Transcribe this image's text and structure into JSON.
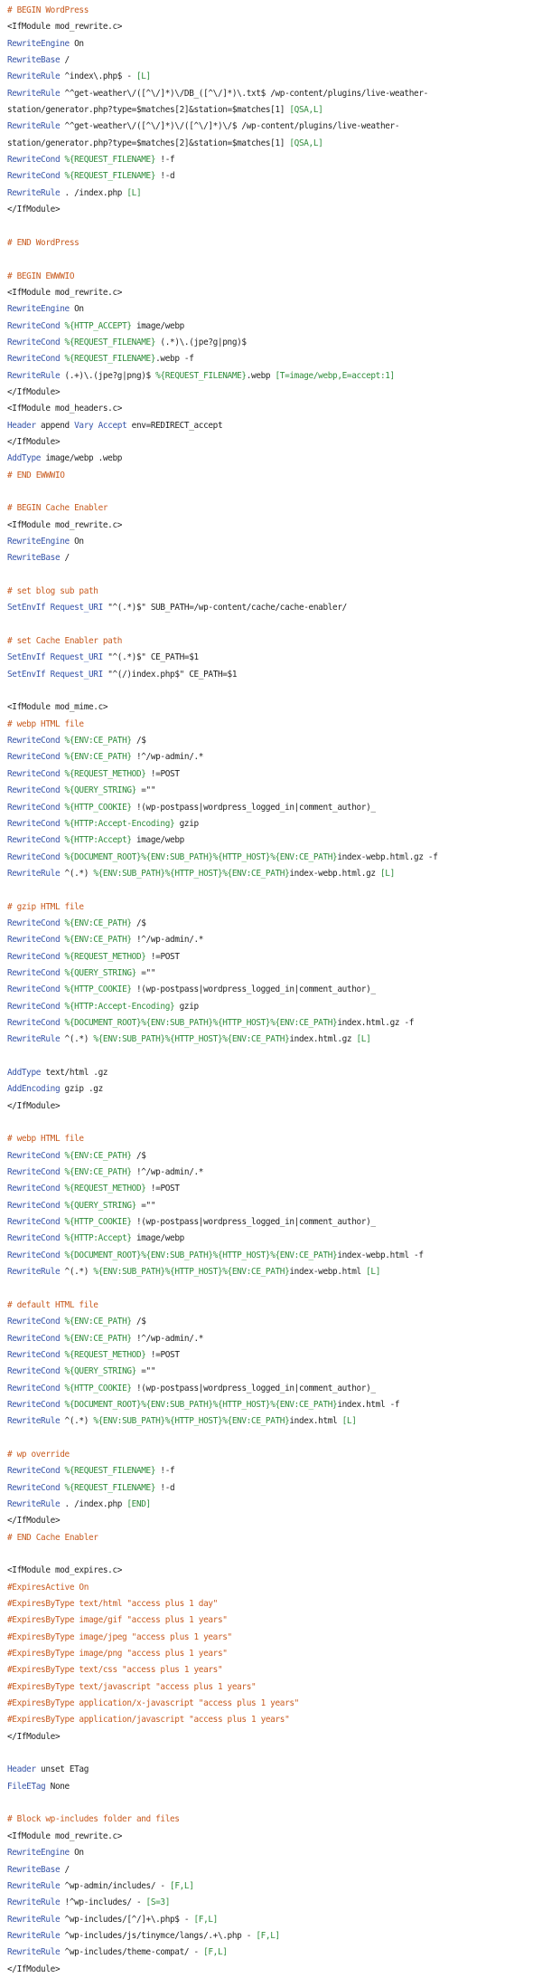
{
  "colors": {
    "comment": "#c85a1e",
    "directive": "#3553a8",
    "variable": "#2e8b3a",
    "text": "#222222",
    "background": "#ffffff"
  },
  "lines": [
    [
      [
        "c",
        "# BEGIN WordPress"
      ]
    ],
    [
      [
        "t",
        "<IfModule mod_rewrite.c>"
      ]
    ],
    [
      [
        "d",
        "RewriteEngine"
      ],
      [
        "p",
        " On"
      ]
    ],
    [
      [
        "d",
        "RewriteBase"
      ],
      [
        "p",
        " /"
      ]
    ],
    [
      [
        "d",
        "RewriteRule"
      ],
      [
        "p",
        " ^index\\.php$ - "
      ],
      [
        "f",
        "[L]"
      ]
    ],
    [
      [
        "d",
        "RewriteRule"
      ],
      [
        "p",
        " ^^get-weather\\/([^\\/]*)\\/DB_([^\\/]*)\\.txt$ /wp-content/plugins/live-weather-"
      ]
    ],
    [
      [
        "p",
        "station/generator.php?type=$matches[2]&station=$matches[1] "
      ],
      [
        "f",
        "[QSA,L]"
      ]
    ],
    [
      [
        "d",
        "RewriteRule"
      ],
      [
        "p",
        " ^^get-weather\\/([^\\/]*)\\/([^\\/]*)\\/$ /wp-content/plugins/live-weather-"
      ]
    ],
    [
      [
        "p",
        "station/generator.php?type=$matches[2]&station=$matches[1] "
      ],
      [
        "f",
        "[QSA,L]"
      ]
    ],
    [
      [
        "d",
        "RewriteCond"
      ],
      [
        "p",
        " "
      ],
      [
        "v",
        "%{REQUEST_FILENAME}"
      ],
      [
        "p",
        " !-f"
      ]
    ],
    [
      [
        "d",
        "RewriteCond"
      ],
      [
        "p",
        " "
      ],
      [
        "v",
        "%{REQUEST_FILENAME}"
      ],
      [
        "p",
        " !-d"
      ]
    ],
    [
      [
        "d",
        "RewriteRule"
      ],
      [
        "p",
        " . /index.php "
      ],
      [
        "f",
        "[L]"
      ]
    ],
    [
      [
        "t",
        "</IfModule>"
      ]
    ],
    [],
    [
      [
        "c",
        "# END WordPress"
      ]
    ],
    [],
    [
      [
        "c",
        "# BEGIN EWWWIO"
      ]
    ],
    [
      [
        "t",
        "<IfModule mod_rewrite.c>"
      ]
    ],
    [
      [
        "d",
        "RewriteEngine"
      ],
      [
        "p",
        " On"
      ]
    ],
    [
      [
        "d",
        "RewriteCond"
      ],
      [
        "p",
        " "
      ],
      [
        "v",
        "%{HTTP_ACCEPT}"
      ],
      [
        "p",
        " image/webp"
      ]
    ],
    [
      [
        "d",
        "RewriteCond"
      ],
      [
        "p",
        " "
      ],
      [
        "v",
        "%{REQUEST_FILENAME}"
      ],
      [
        "p",
        " (.*)\\.(jpe?g|png)$"
      ]
    ],
    [
      [
        "d",
        "RewriteCond"
      ],
      [
        "p",
        " "
      ],
      [
        "v",
        "%{REQUEST_FILENAME}"
      ],
      [
        "p",
        ".webp -f"
      ]
    ],
    [
      [
        "d",
        "RewriteRule"
      ],
      [
        "p",
        " (.+)\\.(jpe?g|png)$ "
      ],
      [
        "v",
        "%{REQUEST_FILENAME}"
      ],
      [
        "p",
        ".webp "
      ],
      [
        "f",
        "[T=image/webp,E=accept:1]"
      ]
    ],
    [
      [
        "t",
        "</IfModule>"
      ]
    ],
    [
      [
        "t",
        "<IfModule mod_headers.c>"
      ]
    ],
    [
      [
        "d",
        "Header"
      ],
      [
        "p",
        " append "
      ],
      [
        "d",
        "Vary"
      ],
      [
        "p",
        " "
      ],
      [
        "d",
        "Accept"
      ],
      [
        "p",
        " env=REDIRECT_accept"
      ]
    ],
    [
      [
        "t",
        "</IfModule>"
      ]
    ],
    [
      [
        "d",
        "AddType"
      ],
      [
        "p",
        " image/webp .webp"
      ]
    ],
    [
      [
        "c",
        "# END EWWWIO"
      ]
    ],
    [],
    [
      [
        "c",
        "# BEGIN Cache Enabler"
      ]
    ],
    [
      [
        "t",
        "<IfModule mod_rewrite.c>"
      ]
    ],
    [
      [
        "d",
        "RewriteEngine"
      ],
      [
        "p",
        " On"
      ]
    ],
    [
      [
        "d",
        "RewriteBase"
      ],
      [
        "p",
        " /"
      ]
    ],
    [],
    [
      [
        "c",
        "# set blog sub path"
      ]
    ],
    [
      [
        "d",
        "SetEnvIf"
      ],
      [
        "p",
        " "
      ],
      [
        "d",
        "Request_URI"
      ],
      [
        "p",
        " \"^(.*)$\" SUB_PATH=/wp-content/cache/cache-enabler/"
      ]
    ],
    [],
    [
      [
        "c",
        "# set Cache Enabler path"
      ]
    ],
    [
      [
        "d",
        "SetEnvIf"
      ],
      [
        "p",
        " "
      ],
      [
        "d",
        "Request_URI"
      ],
      [
        "p",
        " \"^(.*)$\" CE_PATH=$1"
      ]
    ],
    [
      [
        "d",
        "SetEnvIf"
      ],
      [
        "p",
        " "
      ],
      [
        "d",
        "Request_URI"
      ],
      [
        "p",
        " \"^(/)index.php$\" CE_PATH=$1"
      ]
    ],
    [],
    [
      [
        "t",
        "<IfModule mod_mime.c>"
      ]
    ],
    [
      [
        "c",
        "# webp HTML file"
      ]
    ],
    [
      [
        "d",
        "RewriteCond"
      ],
      [
        "p",
        " "
      ],
      [
        "v",
        "%{ENV:CE_PATH}"
      ],
      [
        "p",
        " /$"
      ]
    ],
    [
      [
        "d",
        "RewriteCond"
      ],
      [
        "p",
        " "
      ],
      [
        "v",
        "%{ENV:CE_PATH}"
      ],
      [
        "p",
        " !^/wp-admin/.*"
      ]
    ],
    [
      [
        "d",
        "RewriteCond"
      ],
      [
        "p",
        " "
      ],
      [
        "v",
        "%{REQUEST_METHOD}"
      ],
      [
        "p",
        " !=POST"
      ]
    ],
    [
      [
        "d",
        "RewriteCond"
      ],
      [
        "p",
        " "
      ],
      [
        "v",
        "%{QUERY_STRING}"
      ],
      [
        "p",
        " =\"\""
      ]
    ],
    [
      [
        "d",
        "RewriteCond"
      ],
      [
        "p",
        " "
      ],
      [
        "v",
        "%{HTTP_COOKIE}"
      ],
      [
        "p",
        " !(wp-postpass|wordpress_logged_in|comment_author)_"
      ]
    ],
    [
      [
        "d",
        "RewriteCond"
      ],
      [
        "p",
        " "
      ],
      [
        "v",
        "%{HTTP:Accept-Encoding}"
      ],
      [
        "p",
        " gzip"
      ]
    ],
    [
      [
        "d",
        "RewriteCond"
      ],
      [
        "p",
        " "
      ],
      [
        "v",
        "%{HTTP:Accept}"
      ],
      [
        "p",
        " image/webp"
      ]
    ],
    [
      [
        "d",
        "RewriteCond"
      ],
      [
        "p",
        " "
      ],
      [
        "v",
        "%{DOCUMENT_ROOT}%{ENV:SUB_PATH}%{HTTP_HOST}%{ENV:CE_PATH}"
      ],
      [
        "p",
        "index-webp.html.gz -f"
      ]
    ],
    [
      [
        "d",
        "RewriteRule"
      ],
      [
        "p",
        " ^(.*) "
      ],
      [
        "v",
        "%{ENV:SUB_PATH}%{HTTP_HOST}%{ENV:CE_PATH}"
      ],
      [
        "p",
        "index-webp.html.gz "
      ],
      [
        "f",
        "[L]"
      ]
    ],
    [],
    [
      [
        "c",
        "# gzip HTML file"
      ]
    ],
    [
      [
        "d",
        "RewriteCond"
      ],
      [
        "p",
        " "
      ],
      [
        "v",
        "%{ENV:CE_PATH}"
      ],
      [
        "p",
        " /$"
      ]
    ],
    [
      [
        "d",
        "RewriteCond"
      ],
      [
        "p",
        " "
      ],
      [
        "v",
        "%{ENV:CE_PATH}"
      ],
      [
        "p",
        " !^/wp-admin/.*"
      ]
    ],
    [
      [
        "d",
        "RewriteCond"
      ],
      [
        "p",
        " "
      ],
      [
        "v",
        "%{REQUEST_METHOD}"
      ],
      [
        "p",
        " !=POST"
      ]
    ],
    [
      [
        "d",
        "RewriteCond"
      ],
      [
        "p",
        " "
      ],
      [
        "v",
        "%{QUERY_STRING}"
      ],
      [
        "p",
        " =\"\""
      ]
    ],
    [
      [
        "d",
        "RewriteCond"
      ],
      [
        "p",
        " "
      ],
      [
        "v",
        "%{HTTP_COOKIE}"
      ],
      [
        "p",
        " !(wp-postpass|wordpress_logged_in|comment_author)_"
      ]
    ],
    [
      [
        "d",
        "RewriteCond"
      ],
      [
        "p",
        " "
      ],
      [
        "v",
        "%{HTTP:Accept-Encoding}"
      ],
      [
        "p",
        " gzip"
      ]
    ],
    [
      [
        "d",
        "RewriteCond"
      ],
      [
        "p",
        " "
      ],
      [
        "v",
        "%{DOCUMENT_ROOT}%{ENV:SUB_PATH}%{HTTP_HOST}%{ENV:CE_PATH}"
      ],
      [
        "p",
        "index.html.gz -f"
      ]
    ],
    [
      [
        "d",
        "RewriteRule"
      ],
      [
        "p",
        " ^(.*) "
      ],
      [
        "v",
        "%{ENV:SUB_PATH}%{HTTP_HOST}%{ENV:CE_PATH}"
      ],
      [
        "p",
        "index.html.gz "
      ],
      [
        "f",
        "[L]"
      ]
    ],
    [],
    [
      [
        "d",
        "AddType"
      ],
      [
        "p",
        " text/html .gz"
      ]
    ],
    [
      [
        "d",
        "AddEncoding"
      ],
      [
        "p",
        " gzip .gz"
      ]
    ],
    [
      [
        "t",
        "</IfModule>"
      ]
    ],
    [],
    [
      [
        "c",
        "# webp HTML file"
      ]
    ],
    [
      [
        "d",
        "RewriteCond"
      ],
      [
        "p",
        " "
      ],
      [
        "v",
        "%{ENV:CE_PATH}"
      ],
      [
        "p",
        " /$"
      ]
    ],
    [
      [
        "d",
        "RewriteCond"
      ],
      [
        "p",
        " "
      ],
      [
        "v",
        "%{ENV:CE_PATH}"
      ],
      [
        "p",
        " !^/wp-admin/.*"
      ]
    ],
    [
      [
        "d",
        "RewriteCond"
      ],
      [
        "p",
        " "
      ],
      [
        "v",
        "%{REQUEST_METHOD}"
      ],
      [
        "p",
        " !=POST"
      ]
    ],
    [
      [
        "d",
        "RewriteCond"
      ],
      [
        "p",
        " "
      ],
      [
        "v",
        "%{QUERY_STRING}"
      ],
      [
        "p",
        " =\"\""
      ]
    ],
    [
      [
        "d",
        "RewriteCond"
      ],
      [
        "p",
        " "
      ],
      [
        "v",
        "%{HTTP_COOKIE}"
      ],
      [
        "p",
        " !(wp-postpass|wordpress_logged_in|comment_author)_"
      ]
    ],
    [
      [
        "d",
        "RewriteCond"
      ],
      [
        "p",
        " "
      ],
      [
        "v",
        "%{HTTP:Accept}"
      ],
      [
        "p",
        " image/webp"
      ]
    ],
    [
      [
        "d",
        "RewriteCond"
      ],
      [
        "p",
        " "
      ],
      [
        "v",
        "%{DOCUMENT_ROOT}%{ENV:SUB_PATH}%{HTTP_HOST}%{ENV:CE_PATH}"
      ],
      [
        "p",
        "index-webp.html -f"
      ]
    ],
    [
      [
        "d",
        "RewriteRule"
      ],
      [
        "p",
        " ^(.*) "
      ],
      [
        "v",
        "%{ENV:SUB_PATH}%{HTTP_HOST}%{ENV:CE_PATH}"
      ],
      [
        "p",
        "index-webp.html "
      ],
      [
        "f",
        "[L]"
      ]
    ],
    [],
    [
      [
        "c",
        "# default HTML file"
      ]
    ],
    [
      [
        "d",
        "RewriteCond"
      ],
      [
        "p",
        " "
      ],
      [
        "v",
        "%{ENV:CE_PATH}"
      ],
      [
        "p",
        " /$"
      ]
    ],
    [
      [
        "d",
        "RewriteCond"
      ],
      [
        "p",
        " "
      ],
      [
        "v",
        "%{ENV:CE_PATH}"
      ],
      [
        "p",
        " !^/wp-admin/.*"
      ]
    ],
    [
      [
        "d",
        "RewriteCond"
      ],
      [
        "p",
        " "
      ],
      [
        "v",
        "%{REQUEST_METHOD}"
      ],
      [
        "p",
        " !=POST"
      ]
    ],
    [
      [
        "d",
        "RewriteCond"
      ],
      [
        "p",
        " "
      ],
      [
        "v",
        "%{QUERY_STRING}"
      ],
      [
        "p",
        " =\"\""
      ]
    ],
    [
      [
        "d",
        "RewriteCond"
      ],
      [
        "p",
        " "
      ],
      [
        "v",
        "%{HTTP_COOKIE}"
      ],
      [
        "p",
        " !(wp-postpass|wordpress_logged_in|comment_author)_"
      ]
    ],
    [
      [
        "d",
        "RewriteCond"
      ],
      [
        "p",
        " "
      ],
      [
        "v",
        "%{DOCUMENT_ROOT}%{ENV:SUB_PATH}%{HTTP_HOST}%{ENV:CE_PATH}"
      ],
      [
        "p",
        "index.html -f"
      ]
    ],
    [
      [
        "d",
        "RewriteRule"
      ],
      [
        "p",
        " ^(.*) "
      ],
      [
        "v",
        "%{ENV:SUB_PATH}%{HTTP_HOST}%{ENV:CE_PATH}"
      ],
      [
        "p",
        "index.html "
      ],
      [
        "f",
        "[L]"
      ]
    ],
    [],
    [
      [
        "c",
        "# wp override"
      ]
    ],
    [
      [
        "d",
        "RewriteCond"
      ],
      [
        "p",
        " "
      ],
      [
        "v",
        "%{REQUEST_FILENAME}"
      ],
      [
        "p",
        " !-f"
      ]
    ],
    [
      [
        "d",
        "RewriteCond"
      ],
      [
        "p",
        " "
      ],
      [
        "v",
        "%{REQUEST_FILENAME}"
      ],
      [
        "p",
        " !-d"
      ]
    ],
    [
      [
        "d",
        "RewriteRule"
      ],
      [
        "p",
        " . /index.php "
      ],
      [
        "f",
        "[END]"
      ]
    ],
    [
      [
        "t",
        "</IfModule>"
      ]
    ],
    [
      [
        "c",
        "# END Cache Enabler"
      ]
    ],
    [],
    [
      [
        "t",
        "<IfModule mod_expires.c>"
      ]
    ],
    [
      [
        "c",
        "#ExpiresActive On"
      ]
    ],
    [
      [
        "c",
        "#ExpiresByType text/html \"access plus 1 day\""
      ]
    ],
    [
      [
        "c",
        "#ExpiresByType image/gif \"access plus 1 years\""
      ]
    ],
    [
      [
        "c",
        "#ExpiresByType image/jpeg \"access plus 1 years\""
      ]
    ],
    [
      [
        "c",
        "#ExpiresByType image/png \"access plus 1 years\""
      ]
    ],
    [
      [
        "c",
        "#ExpiresByType text/css \"access plus 1 years\""
      ]
    ],
    [
      [
        "c",
        "#ExpiresByType text/javascript \"access plus 1 years\""
      ]
    ],
    [
      [
        "c",
        "#ExpiresByType application/x-javascript \"access plus 1 years\""
      ]
    ],
    [
      [
        "c",
        "#ExpiresByType application/javascript \"access plus 1 years\""
      ]
    ],
    [
      [
        "t",
        "</IfModule>"
      ]
    ],
    [],
    [
      [
        "d",
        "Header"
      ],
      [
        "p",
        " unset ETag"
      ]
    ],
    [
      [
        "d",
        "FileETag"
      ],
      [
        "p",
        " None"
      ]
    ],
    [],
    [
      [
        "c",
        "# Block wp-includes folder and files"
      ]
    ],
    [
      [
        "t",
        "<IfModule mod_rewrite.c>"
      ]
    ],
    [
      [
        "d",
        "RewriteEngine"
      ],
      [
        "p",
        " On"
      ]
    ],
    [
      [
        "d",
        "RewriteBase"
      ],
      [
        "p",
        " /"
      ]
    ],
    [
      [
        "d",
        "RewriteRule"
      ],
      [
        "p",
        " ^wp-admin/includes/ - "
      ],
      [
        "f",
        "[F,L]"
      ]
    ],
    [
      [
        "d",
        "RewriteRule"
      ],
      [
        "p",
        " !^wp-includes/ - "
      ],
      [
        "f",
        "[S=3]"
      ]
    ],
    [
      [
        "d",
        "RewriteRule"
      ],
      [
        "p",
        " ^wp-includes/[^/]+\\.php$ - "
      ],
      [
        "f",
        "[F,L]"
      ]
    ],
    [
      [
        "d",
        "RewriteRule"
      ],
      [
        "p",
        " ^wp-includes/js/tinymce/langs/.+\\.php - "
      ],
      [
        "f",
        "[F,L]"
      ]
    ],
    [
      [
        "d",
        "RewriteRule"
      ],
      [
        "p",
        " ^wp-includes/theme-compat/ - "
      ],
      [
        "f",
        "[F,L]"
      ]
    ],
    [
      [
        "t",
        "</IfModule>"
      ]
    ]
  ]
}
